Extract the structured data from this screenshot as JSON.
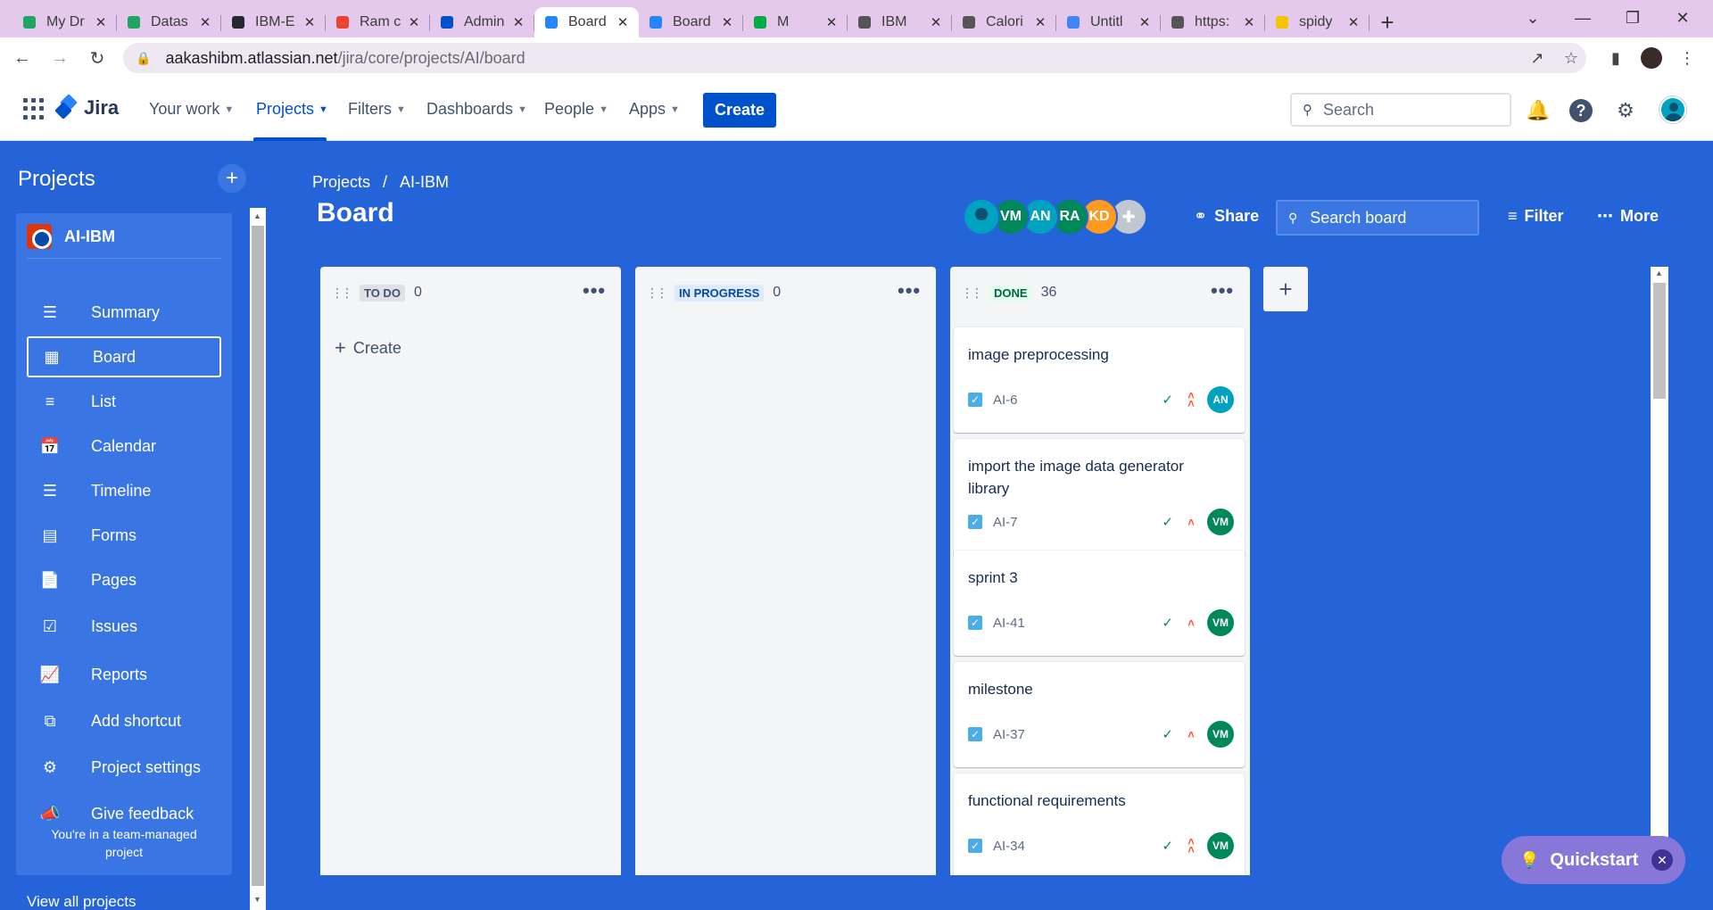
{
  "browser": {
    "tabs": [
      {
        "title": "My Dr",
        "icon": "google-drive-icon",
        "color": "#1FA463"
      },
      {
        "title": "Datas",
        "icon": "google-drive-icon",
        "color": "#1FA463"
      },
      {
        "title": "IBM-E",
        "icon": "github-icon",
        "color": "#24292F"
      },
      {
        "title": "Ram c",
        "icon": "gmail-icon",
        "color": "#EA4335"
      },
      {
        "title": "Admin",
        "icon": "atlassian-icon",
        "color": "#0052CC"
      },
      {
        "title": "Board",
        "icon": "jira-icon",
        "color": "#2684FF",
        "active": true
      },
      {
        "title": "Board",
        "icon": "jira-icon",
        "color": "#2684FF"
      },
      {
        "title": "M",
        "icon": "google-meet-icon",
        "color": "#00AC47"
      },
      {
        "title": "IBM",
        "icon": "globe-icon",
        "color": "#555555"
      },
      {
        "title": "Calori",
        "icon": "globe-icon",
        "color": "#555555"
      },
      {
        "title": "Untitl",
        "icon": "google-docs-icon",
        "color": "#4285F4"
      },
      {
        "title": "https:",
        "icon": "globe-icon",
        "color": "#555555"
      },
      {
        "title": "spidy",
        "icon": "bug-icon",
        "color": "#F2C500"
      }
    ],
    "url_host": "aakashibm.atlassian.net",
    "url_path": "/jira/core/projects/AI/board"
  },
  "topnav": {
    "logo": "Jira",
    "items": [
      {
        "label": "Your work",
        "active": false
      },
      {
        "label": "Projects",
        "active": true
      },
      {
        "label": "Filters",
        "active": false
      },
      {
        "label": "Dashboards",
        "active": false
      },
      {
        "label": "People",
        "active": false
      },
      {
        "label": "Apps",
        "active": false
      }
    ],
    "create_label": "Create",
    "search_placeholder": "Search"
  },
  "sidebar": {
    "title": "Projects",
    "project_name": "AI-IBM",
    "items": [
      {
        "label": "Summary",
        "icon": "summary-icon",
        "selected": false
      },
      {
        "label": "Board",
        "icon": "board-icon",
        "selected": true
      },
      {
        "label": "List",
        "icon": "list-icon",
        "selected": false
      },
      {
        "label": "Calendar",
        "icon": "calendar-icon",
        "selected": false
      },
      {
        "label": "Timeline",
        "icon": "timeline-icon",
        "selected": false
      },
      {
        "label": "Forms",
        "icon": "forms-icon",
        "selected": false
      },
      {
        "label": "Pages",
        "icon": "pages-icon",
        "selected": false
      },
      {
        "label": "Issues",
        "icon": "issues-icon",
        "selected": false
      },
      {
        "label": "Reports",
        "icon": "reports-icon",
        "selected": false
      },
      {
        "label": "Add shortcut",
        "icon": "add-shortcut-icon",
        "selected": false
      },
      {
        "label": "Project settings",
        "icon": "gear-icon",
        "selected": false
      },
      {
        "label": "Give feedback",
        "icon": "megaphone-icon",
        "selected": false
      }
    ],
    "note_line1": "You're in a team-managed",
    "note_line2": "project",
    "view_all": "View all projects"
  },
  "main": {
    "breadcrumb": [
      "Projects",
      "/",
      "AI-IBM"
    ],
    "title": "Board",
    "avatars": [
      {
        "initials": "",
        "color": "#00A3BF",
        "kind": "photo"
      },
      {
        "initials": "VM",
        "color": "#00875A"
      },
      {
        "initials": "AN",
        "color": "#00A3BF"
      },
      {
        "initials": "RA",
        "color": "#00875A"
      },
      {
        "initials": "KD",
        "color": "#FF991F"
      },
      {
        "initials": "",
        "color": "#C1C7D0",
        "kind": "add"
      }
    ],
    "share_label": "Share",
    "search_placeholder": "Search board",
    "filter_label": "Filter",
    "more_label": "More"
  },
  "columns": [
    {
      "name": "TO DO",
      "count": "0",
      "lozenge_bg": "#DFE1E6",
      "lozenge_fg": "#42526E",
      "create_label": "Create"
    },
    {
      "name": "IN PROGRESS",
      "count": "0",
      "lozenge_bg": "#DEEBFF",
      "lozenge_fg": "#0747A6"
    },
    {
      "name": "DONE",
      "count": "36",
      "lozenge_bg": "#E3FCEF",
      "lozenge_fg": "#006644"
    }
  ],
  "cards": [
    {
      "title": "image preprocessing",
      "key": "AI-6",
      "priority": "high",
      "assignee": "AN",
      "color": "#00A3BF"
    },
    {
      "title": "import the image data generator library",
      "key": "AI-7",
      "priority": "medium",
      "assignee": "VM",
      "color": "#00875A"
    },
    {
      "title": "sprint 3",
      "key": "AI-41",
      "priority": "medium",
      "assignee": "VM",
      "color": "#00875A"
    },
    {
      "title": "milestone",
      "key": "AI-37",
      "priority": "medium",
      "assignee": "VM",
      "color": "#00875A"
    },
    {
      "title": "functional requirements",
      "key": "AI-34",
      "priority": "high",
      "assignee": "VM",
      "color": "#00875A"
    }
  ],
  "quickstart_label": "Quickstart"
}
